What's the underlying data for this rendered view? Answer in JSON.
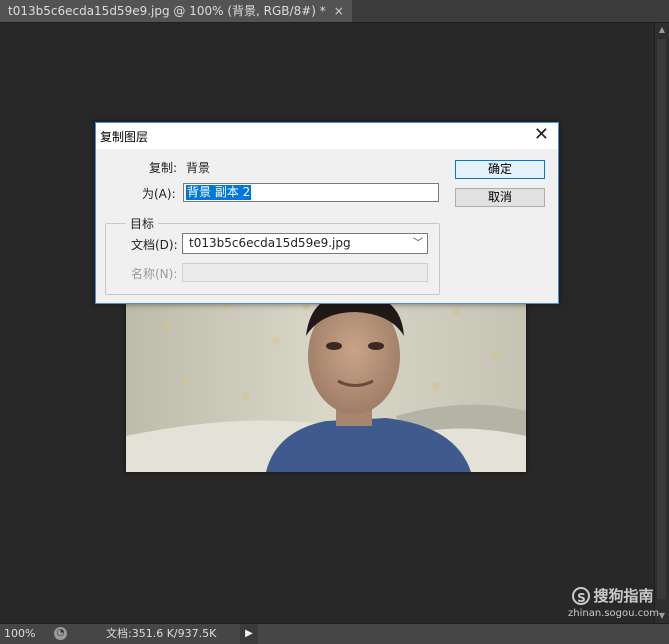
{
  "document_tab": {
    "title": "t013b5c6ecda15d59e9.jpg @ 100% (背景, RGB/8#) *",
    "close_glyph": "×"
  },
  "dialog": {
    "title": "复制图层",
    "close_glyph": "✕",
    "copy_label": "复制:",
    "copy_value": "背景",
    "as_label": "为(A):",
    "as_value": "背景 副本 2",
    "destination_legend": "目标",
    "document_label": "文档(D):",
    "document_value": "t013b5c6ecda15d59e9.jpg",
    "name_label": "名称(N):",
    "name_value": "",
    "ok_label": "确定",
    "cancel_label": "取消"
  },
  "status_bar": {
    "zoom": "100%",
    "doc_info": "文档:351.6 K/937.5K",
    "arrow_glyph": "▶"
  },
  "watermark": {
    "logo_glyph": "S",
    "brand": "搜狗指南",
    "url": "zhinan.sogou.com"
  },
  "colors": {
    "selection": "#0078d7",
    "dialog_border": "#4a90d9",
    "app_background": "#282828"
  }
}
